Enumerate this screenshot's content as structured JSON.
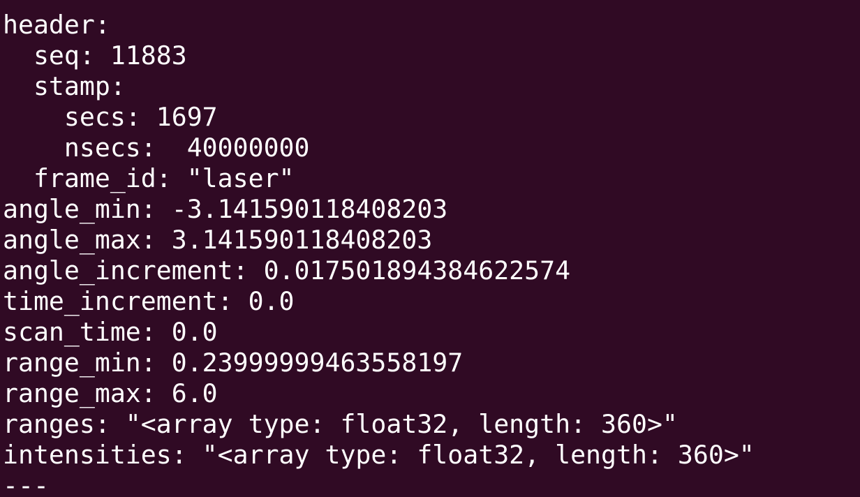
{
  "terminal": {
    "background": "#300a24",
    "foreground": "#ffffff",
    "lines": [
      "header:",
      "  seq: 11883",
      "  stamp:",
      "    secs: 1697",
      "    nsecs:  40000000",
      "  frame_id: \"laser\"",
      "angle_min: -3.141590118408203",
      "angle_max: 3.141590118408203",
      "angle_increment: 0.017501894384622574",
      "time_increment: 0.0",
      "scan_time: 0.0",
      "range_min: 0.23999999463558197",
      "range_max: 6.0",
      "ranges: \"<array type: float32, length: 360>\"",
      "intensities: \"<array type: float32, length: 360>\"",
      "---"
    ]
  }
}
